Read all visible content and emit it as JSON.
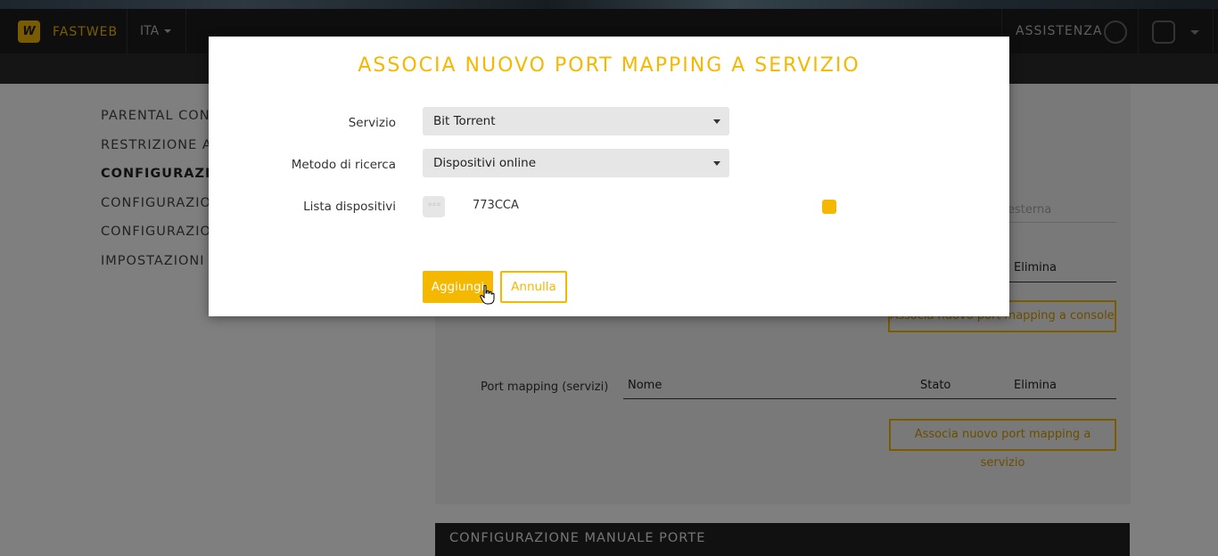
{
  "header": {
    "brand": "FASTWEB",
    "language": "ITA",
    "assist": "ASSISTENZA"
  },
  "sidebar": {
    "items": [
      {
        "label": "PARENTAL CONTROL",
        "active": false
      },
      {
        "label": "RESTRIZIONE ACCESSO",
        "active": false
      },
      {
        "label": "CONFIGURAZIONE",
        "active": true
      },
      {
        "label": "CONFIGURAZIONE",
        "active": false
      },
      {
        "label": "CONFIGURAZIONE",
        "active": false
      },
      {
        "label": "IMPOSTAZIONI LAN",
        "active": false
      }
    ]
  },
  "background": {
    "external_placeholder": "esterna",
    "console_table": {
      "delete_header": "Elimina"
    },
    "console_button": "Associa nuovo port mapping a console",
    "services_label": "Port mapping (servizi)",
    "services_table": {
      "name_header": "Nome",
      "state_header": "Stato",
      "delete_header": "Elimina"
    },
    "services_button": "Associa nuovo port mapping a servizio",
    "manual_section": "CONFIGURAZIONE MANUALE PORTE"
  },
  "modal": {
    "title": "ASSOCIA NUOVO PORT MAPPING A SERVIZIO",
    "service_label": "Servizio",
    "service_value": "Bit Torrent",
    "method_label": "Metodo di ricerca",
    "method_value": "Dispositivi online",
    "devices_label": "Lista dispositivi",
    "devices": [
      {
        "name": "773CCA",
        "selected": true
      }
    ],
    "add_button": "Aggiungi",
    "cancel_button": "Annulla"
  },
  "colors": {
    "accent": "#f5b800",
    "header_bg": "#1c1c1c"
  }
}
